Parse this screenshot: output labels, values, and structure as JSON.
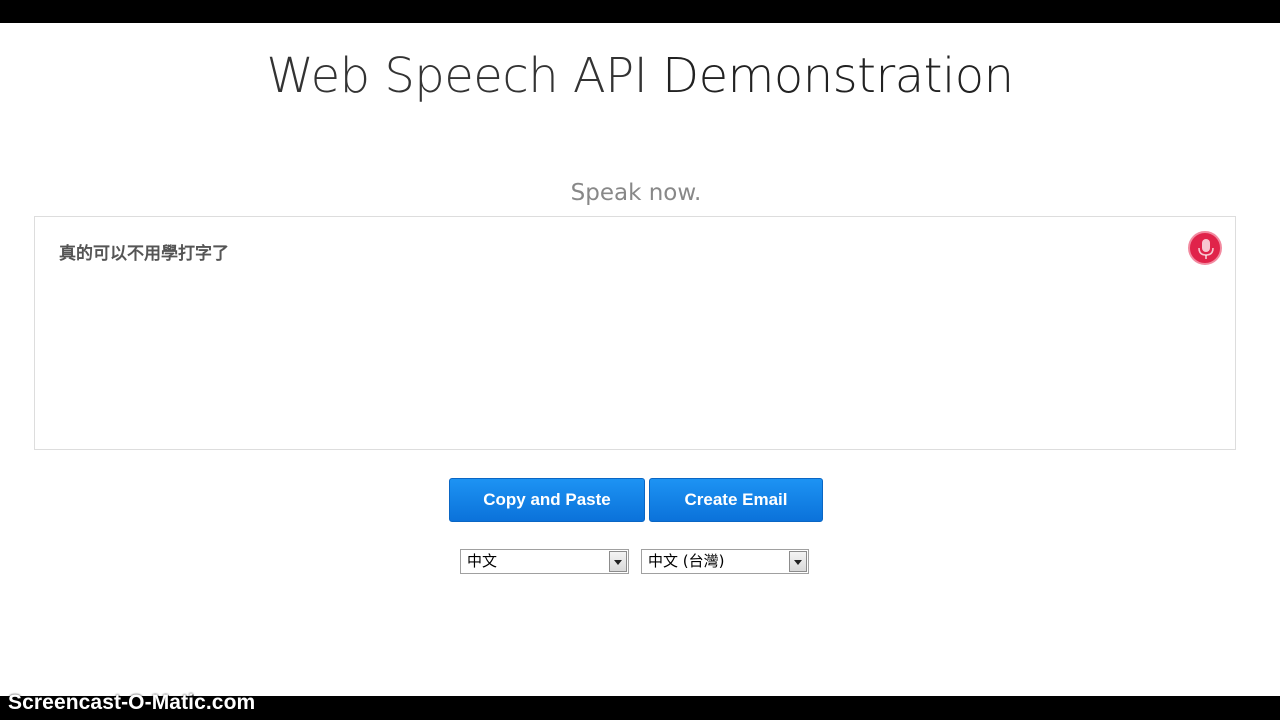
{
  "page": {
    "title_main": "Web Speech API",
    "title_rest": " Demonstration",
    "status": "Speak now."
  },
  "results": {
    "transcript": "真的可以不用學打字了"
  },
  "mic": {
    "icon": "microphone-icon",
    "color": "#e0234a"
  },
  "buttons": {
    "copy_label": "Copy and Paste",
    "email_label": "Create Email"
  },
  "selects": {
    "language": "中文",
    "dialect": "中文 (台灣)"
  },
  "overlay": {
    "watermark": "Screencast-O-Matic.com"
  }
}
